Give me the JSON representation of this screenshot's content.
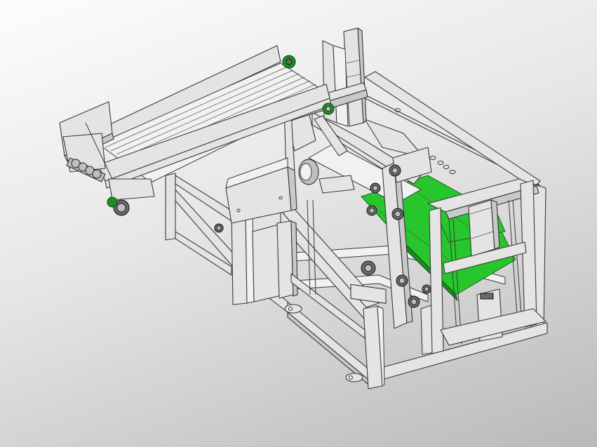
{
  "viewport": {
    "background": "#d9d9d9",
    "steel_color": "#e4e4e4",
    "edge_color": "#3a3a3a",
    "belt_color": "#27c62d",
    "sprocket_color": "#1c8f22"
  },
  "model": {
    "components": [
      "base-frame",
      "inclined-conveyor",
      "green-belt-conveyor",
      "rear-lift-frame",
      "vertical-cylinder",
      "sprockets"
    ]
  }
}
